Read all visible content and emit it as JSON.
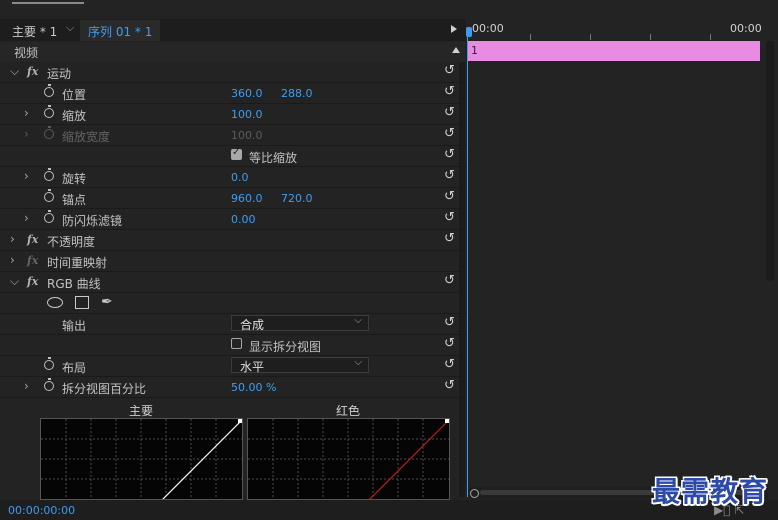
{
  "tabs": {
    "main_label": "主要 * 1",
    "sequence_label": "序列 01 * 1"
  },
  "timeline": {
    "time_start": "00:00",
    "time_end": "00:00",
    "clip_label": "1",
    "clip_color": "#e98ae3"
  },
  "panel": {
    "section_video": "视频"
  },
  "rows": {
    "motion": "运动",
    "position": {
      "label": "位置",
      "x": "360.0",
      "y": "288.0"
    },
    "scale": {
      "label": "缩放",
      "value": "100.0"
    },
    "scale_width": {
      "label": "缩放宽度",
      "value": "100.0"
    },
    "uniform_scale": {
      "label": "等比缩放",
      "checked": true
    },
    "rotation": {
      "label": "旋转",
      "value": "0.0"
    },
    "anchor": {
      "label": "锚点",
      "x": "960.0",
      "y": "720.0"
    },
    "anti_flicker": {
      "label": "防闪烁滤镜",
      "value": "0.00"
    },
    "opacity": "不透明度",
    "time_remap": "时间重映射",
    "rgb_curves": "RGB 曲线",
    "output": {
      "label": "输出",
      "value": "合成"
    },
    "show_split": {
      "label": "显示拆分视图",
      "checked": false
    },
    "layout": {
      "label": "布局",
      "value": "水平"
    },
    "split_percent": {
      "label": "拆分视图百分比",
      "value": "50.00 %"
    }
  },
  "curves": {
    "master_label": "主要",
    "red_label": "红色",
    "master_line_color": "#ffffff",
    "red_line_color": "#c21b1b"
  },
  "status": {
    "timecode": "00:00:00:00"
  },
  "watermark": "最需教育",
  "colors": {
    "accent": "#3f9cf1",
    "background": "#232323"
  }
}
